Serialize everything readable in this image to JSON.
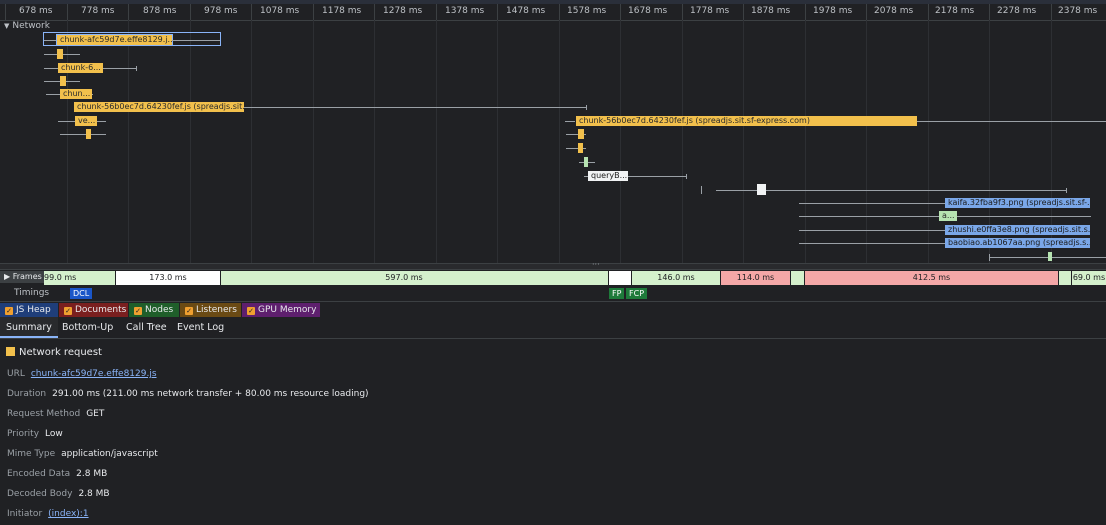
{
  "ruler": {
    "ticks": [
      "678 ms",
      "778 ms",
      "878 ms",
      "978 ms",
      "1078 ms",
      "1178 ms",
      "1278 ms",
      "1378 ms",
      "1478 ms",
      "1578 ms",
      "1678 ms",
      "1778 ms",
      "1878 ms",
      "1978 ms",
      "2078 ms",
      "2178 ms",
      "2278 ms",
      "2378 ms"
    ]
  },
  "network": {
    "track_label": "Network",
    "requests": {
      "chunk_afc": "chunk-afc59d7e.effe8129.j...",
      "chunk_6": "chunk-6...",
      "chun": "chun...",
      "chunk_56_a": "chunk-56b0ec7d.64230fef.js (spreadjs.sit...",
      "ve": "ve...",
      "chunk_56_b": "chunk-56b0ec7d.64230fef.js (spreadjs.sit.sf-express.com)",
      "queryb": "queryB...",
      "kaifa": "kaifa.32fba9f3.png (spreadjs.sit.sf-...",
      "a": "a...",
      "zhushi": "zhushi.e0ffa3e8.png (spreadjs.sit.s...",
      "baobiao": "baobiao.ab1067aa.png (spreadjs.s..."
    }
  },
  "frames": {
    "label": "Frames",
    "items": [
      "99.0 ms",
      "173.0 ms",
      "597.0 ms",
      "146.0 ms",
      "114.0 ms",
      "412.5 ms",
      "69.0 ms"
    ]
  },
  "timings": {
    "label": "Timings",
    "markers": [
      "DCL",
      "FP",
      "FCP"
    ]
  },
  "memory_toggles": [
    "JS Heap",
    "Documents",
    "Nodes",
    "Listeners",
    "GPU Memory"
  ],
  "detail_tabs": [
    "Summary",
    "Bottom-Up",
    "Call Tree",
    "Event Log"
  ],
  "summary": {
    "title": "Network request",
    "rows": [
      {
        "key": "URL",
        "value": "chunk-afc59d7e.effe8129.js"
      },
      {
        "key": "Duration",
        "value": "291.00 ms (211.00 ms network transfer + 80.00 ms resource loading)"
      },
      {
        "key": "Request Method",
        "value": "GET"
      },
      {
        "key": "Priority",
        "value": "Low"
      },
      {
        "key": "Mime Type",
        "value": "application/javascript"
      },
      {
        "key": "Encoded Data",
        "value": "2.8 MB"
      },
      {
        "key": "Decoded Body",
        "value": "2.8 MB"
      },
      {
        "key": "Initiator",
        "value": "(index):1"
      }
    ]
  },
  "colors": {
    "script": "#f2c04c",
    "image": "#7aa7e8",
    "frame_idle": "#d4f0cc",
    "frame_dropped": "#f4a7a7",
    "dcl": "#1a56c8",
    "fp": "#1e7a3a"
  }
}
